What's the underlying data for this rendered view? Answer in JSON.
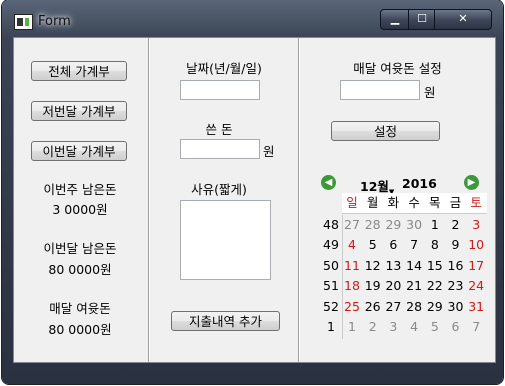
{
  "window": {
    "title": "Form"
  },
  "left": {
    "buttons": [
      "전체 가계부",
      "저번달 가계부",
      "이번달 가계부"
    ],
    "this_week_label": "이번주 남은돈",
    "this_week_value": "3 0000원",
    "this_month_label": "이번달 남은돈",
    "this_month_value": "80 0000원",
    "monthly_label": "매달 여윳돈",
    "monthly_value": "80 0000원"
  },
  "middle": {
    "date_label": "날짜(년/월/일)",
    "date_value": "",
    "spent_label": "쓴 돈",
    "spent_value": "",
    "spent_unit": "원",
    "reason_label": "사유(짧게)",
    "reason_value": "",
    "add_button": "지출내역 추가"
  },
  "right": {
    "setting_label": "매달 여윳돈 설정",
    "setting_value": "",
    "setting_unit": "원",
    "set_button": "설정"
  },
  "calendar": {
    "month": "12월",
    "year": "2016",
    "weekdays": [
      "일",
      "월",
      "화",
      "수",
      "목",
      "금",
      "토"
    ],
    "weeks": [
      {
        "num": "48",
        "days": [
          "27",
          "28",
          "29",
          "30",
          "1",
          "2",
          "3"
        ],
        "other": [
          1,
          1,
          1,
          1,
          0,
          0,
          0
        ]
      },
      {
        "num": "49",
        "days": [
          "4",
          "5",
          "6",
          "7",
          "8",
          "9",
          "10"
        ],
        "other": [
          0,
          0,
          0,
          0,
          0,
          0,
          0
        ]
      },
      {
        "num": "50",
        "days": [
          "11",
          "12",
          "13",
          "14",
          "15",
          "16",
          "17"
        ],
        "other": [
          0,
          0,
          0,
          0,
          0,
          0,
          0
        ]
      },
      {
        "num": "51",
        "days": [
          "18",
          "19",
          "20",
          "21",
          "22",
          "23",
          "24"
        ],
        "other": [
          0,
          0,
          0,
          0,
          0,
          0,
          0
        ]
      },
      {
        "num": "52",
        "days": [
          "25",
          "26",
          "27",
          "28",
          "29",
          "30",
          "31"
        ],
        "other": [
          0,
          0,
          0,
          0,
          0,
          0,
          0
        ]
      },
      {
        "num": "1",
        "days": [
          "1",
          "2",
          "3",
          "4",
          "5",
          "6",
          "7"
        ],
        "other": [
          1,
          1,
          1,
          1,
          1,
          1,
          1
        ]
      }
    ],
    "today": "18",
    "colors": {
      "weekend": "#d11a1a",
      "nav": "#3a9a38",
      "other_month": "#8a8a8a"
    }
  }
}
